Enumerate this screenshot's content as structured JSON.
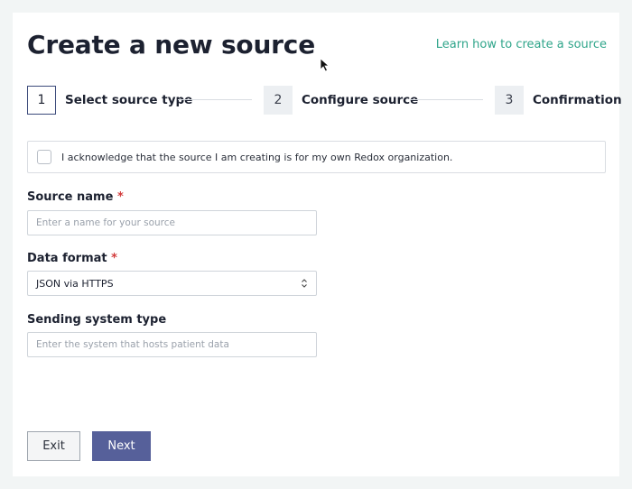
{
  "page": {
    "title": "Create a new source",
    "learn_link": "Learn how to create a source"
  },
  "stepper": {
    "steps": [
      {
        "number": "1",
        "label": "Select source type",
        "active": true
      },
      {
        "number": "2",
        "label": "Configure source",
        "active": false
      },
      {
        "number": "3",
        "label": "Confirmation",
        "active": false
      }
    ]
  },
  "acknowledge": {
    "text": "I acknowledge that the source I am creating is for my own Redox organization.",
    "checked": false
  },
  "form": {
    "source_name": {
      "label": "Source name",
      "required_mark": "*",
      "placeholder": "Enter a name for your source",
      "value": ""
    },
    "data_format": {
      "label": "Data format",
      "required_mark": "*",
      "selected": "JSON via HTTPS"
    },
    "sending_system": {
      "label": "Sending system type",
      "placeholder": "Enter the system that hosts patient data",
      "value": ""
    }
  },
  "actions": {
    "exit_label": "Exit",
    "next_label": "Next"
  },
  "colors": {
    "accent_link": "#2fa58a",
    "primary_button": "#56609a",
    "required": "#d23b3b",
    "active_step_border": "#3b4a7a"
  }
}
